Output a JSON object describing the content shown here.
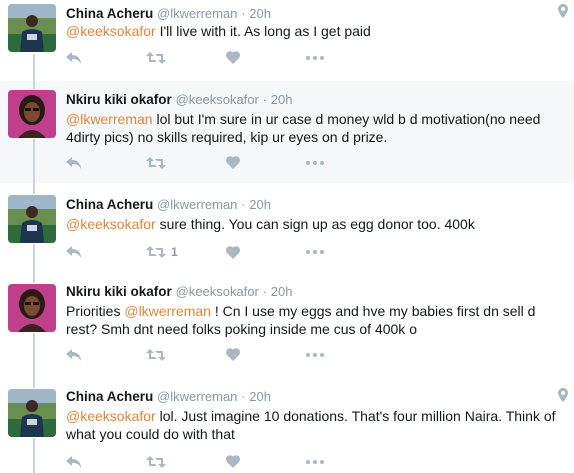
{
  "tweets": [
    {
      "name": "China Acheru",
      "handle": "@lkwerreman",
      "time": "20h",
      "mention": "@keeksokafor",
      "body": " I'll live with it. As long as I get paid",
      "retweets": "",
      "has_geo": true
    },
    {
      "name": "Nkiru kiki okafor",
      "handle": "@keeksokafor",
      "time": "20h",
      "mention": "@lkwerreman",
      "body": " lol but I'm sure in ur case d money wld b d motivation(no need 4dirty pics) no skills required, kip ur eyes on d prize.",
      "retweets": "",
      "has_geo": false
    },
    {
      "name": "China Acheru",
      "handle": "@lkwerreman",
      "time": "20h",
      "mention": "@keeksokafor",
      "body": " sure thing. You can sign up as egg donor too. 400k",
      "retweets": "1",
      "has_geo": false
    },
    {
      "name": "Nkiru kiki okafor",
      "handle": "@keeksokafor",
      "time": "20h",
      "pre": "Priorities ",
      "mention": "@lkwerreman",
      "body": " ! Cn I use my eggs and hve my babies first dn sell d rest? Smh dnt need folks poking inside me cus of 400k o",
      "retweets": "",
      "has_geo": false
    },
    {
      "name": "China Acheru",
      "handle": "@lkwerreman",
      "time": "20h",
      "mention": "@keeksokafor",
      "body": " lol. Just imagine 10 donations. That's four million Naira. Think of what you could do with that",
      "retweets": "",
      "has_geo": true
    }
  ],
  "separator": "·",
  "colors": {
    "mention": "#e0863c",
    "action_icon": "#aab8c2",
    "highlight_bg": "#f5f8fa",
    "thread_line": "#cbd5dc"
  },
  "icons": [
    "reply-icon",
    "retweet-icon",
    "like-icon",
    "more-icon",
    "location-icon"
  ]
}
